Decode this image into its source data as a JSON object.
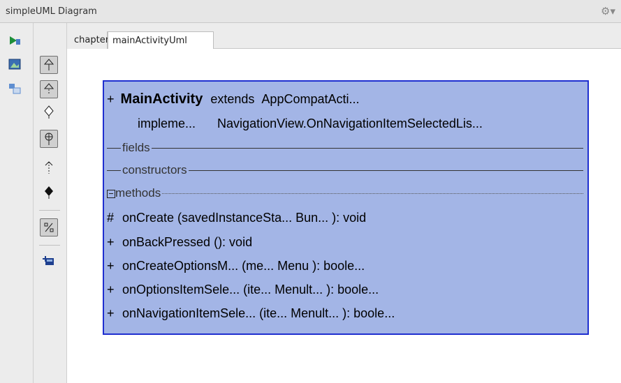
{
  "window": {
    "title": "simpleUML Diagram",
    "gear_icon": "gear-icon"
  },
  "tabs": [
    {
      "label": "chapter_six"
    },
    {
      "label": "mainActivityUml",
      "selected": true
    }
  ],
  "class_box": {
    "visibility": "+",
    "name": "MainActivity",
    "extends_kw": "extends",
    "extends": "AppCompatActi...",
    "implements_kw": "impleme...",
    "implements": "NavigationView.OnNavigationItemSelectedLis...",
    "sections": {
      "fields": "fields",
      "constructors": "constructors",
      "methods": "methods"
    },
    "methods": [
      {
        "vis": "#",
        "text": "onCreate (savedInstanceSta... Bun... ): void"
      },
      {
        "vis": "+",
        "text": "onBackPressed (): void"
      },
      {
        "vis": "+",
        "text": "onCreateOptionsM...   (me...  Menu ): boole..."
      },
      {
        "vis": "+",
        "text": "onOptionsItemSele...   (ite... Menult...  ): boole..."
      },
      {
        "vis": "+",
        "text": "onNavigationItemSele...   (ite... Menult...  ): boole..."
      }
    ],
    "colors": {
      "fill": "#a3b5e6",
      "border": "#1f2fd0"
    }
  }
}
